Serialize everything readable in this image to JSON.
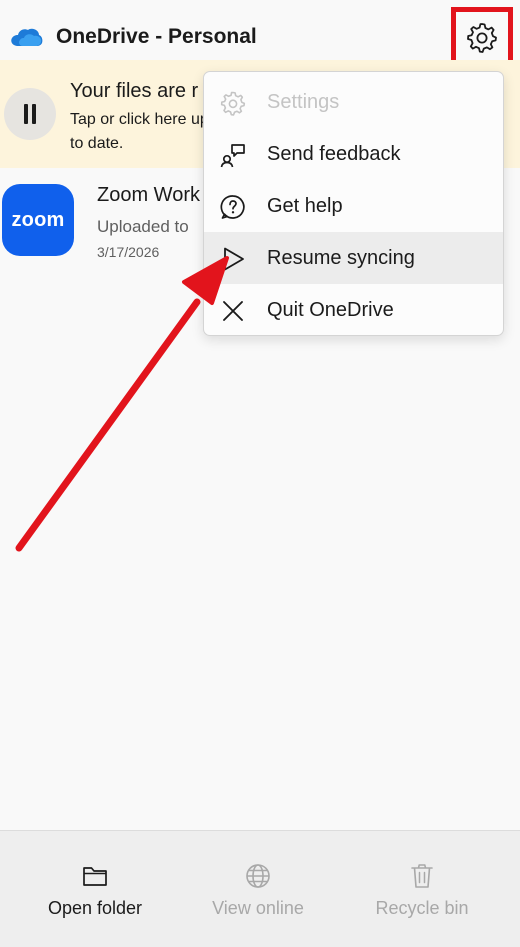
{
  "app": {
    "title": "OneDrive - Personal",
    "accent": "#0f6cbd"
  },
  "header": {
    "settings_icon": "gear-icon",
    "highlight_color": "#e2141c"
  },
  "banner": {
    "title": "Your files are r",
    "subtitle": "Tap or click here up to date.",
    "icon": "pause-icon"
  },
  "file": {
    "app_icon_label": "zoom",
    "name": "Zoom Work",
    "status": "Uploaded to",
    "date": "3/17/2026"
  },
  "menu": {
    "items": [
      {
        "label": "Settings",
        "icon": "gear-icon",
        "disabled": true
      },
      {
        "label": "Send feedback",
        "icon": "feedback-icon",
        "disabled": false
      },
      {
        "label": "Get help",
        "icon": "help-icon",
        "disabled": false
      },
      {
        "label": "Resume syncing",
        "icon": "play-icon",
        "disabled": false
      },
      {
        "label": "Quit OneDrive",
        "icon": "close-icon",
        "disabled": false
      }
    ]
  },
  "annotation": {
    "arrow_color": "#e2141c"
  },
  "bottom": {
    "open_folder": "Open folder",
    "view_online": "View online",
    "recycle_bin": "Recycle bin"
  }
}
